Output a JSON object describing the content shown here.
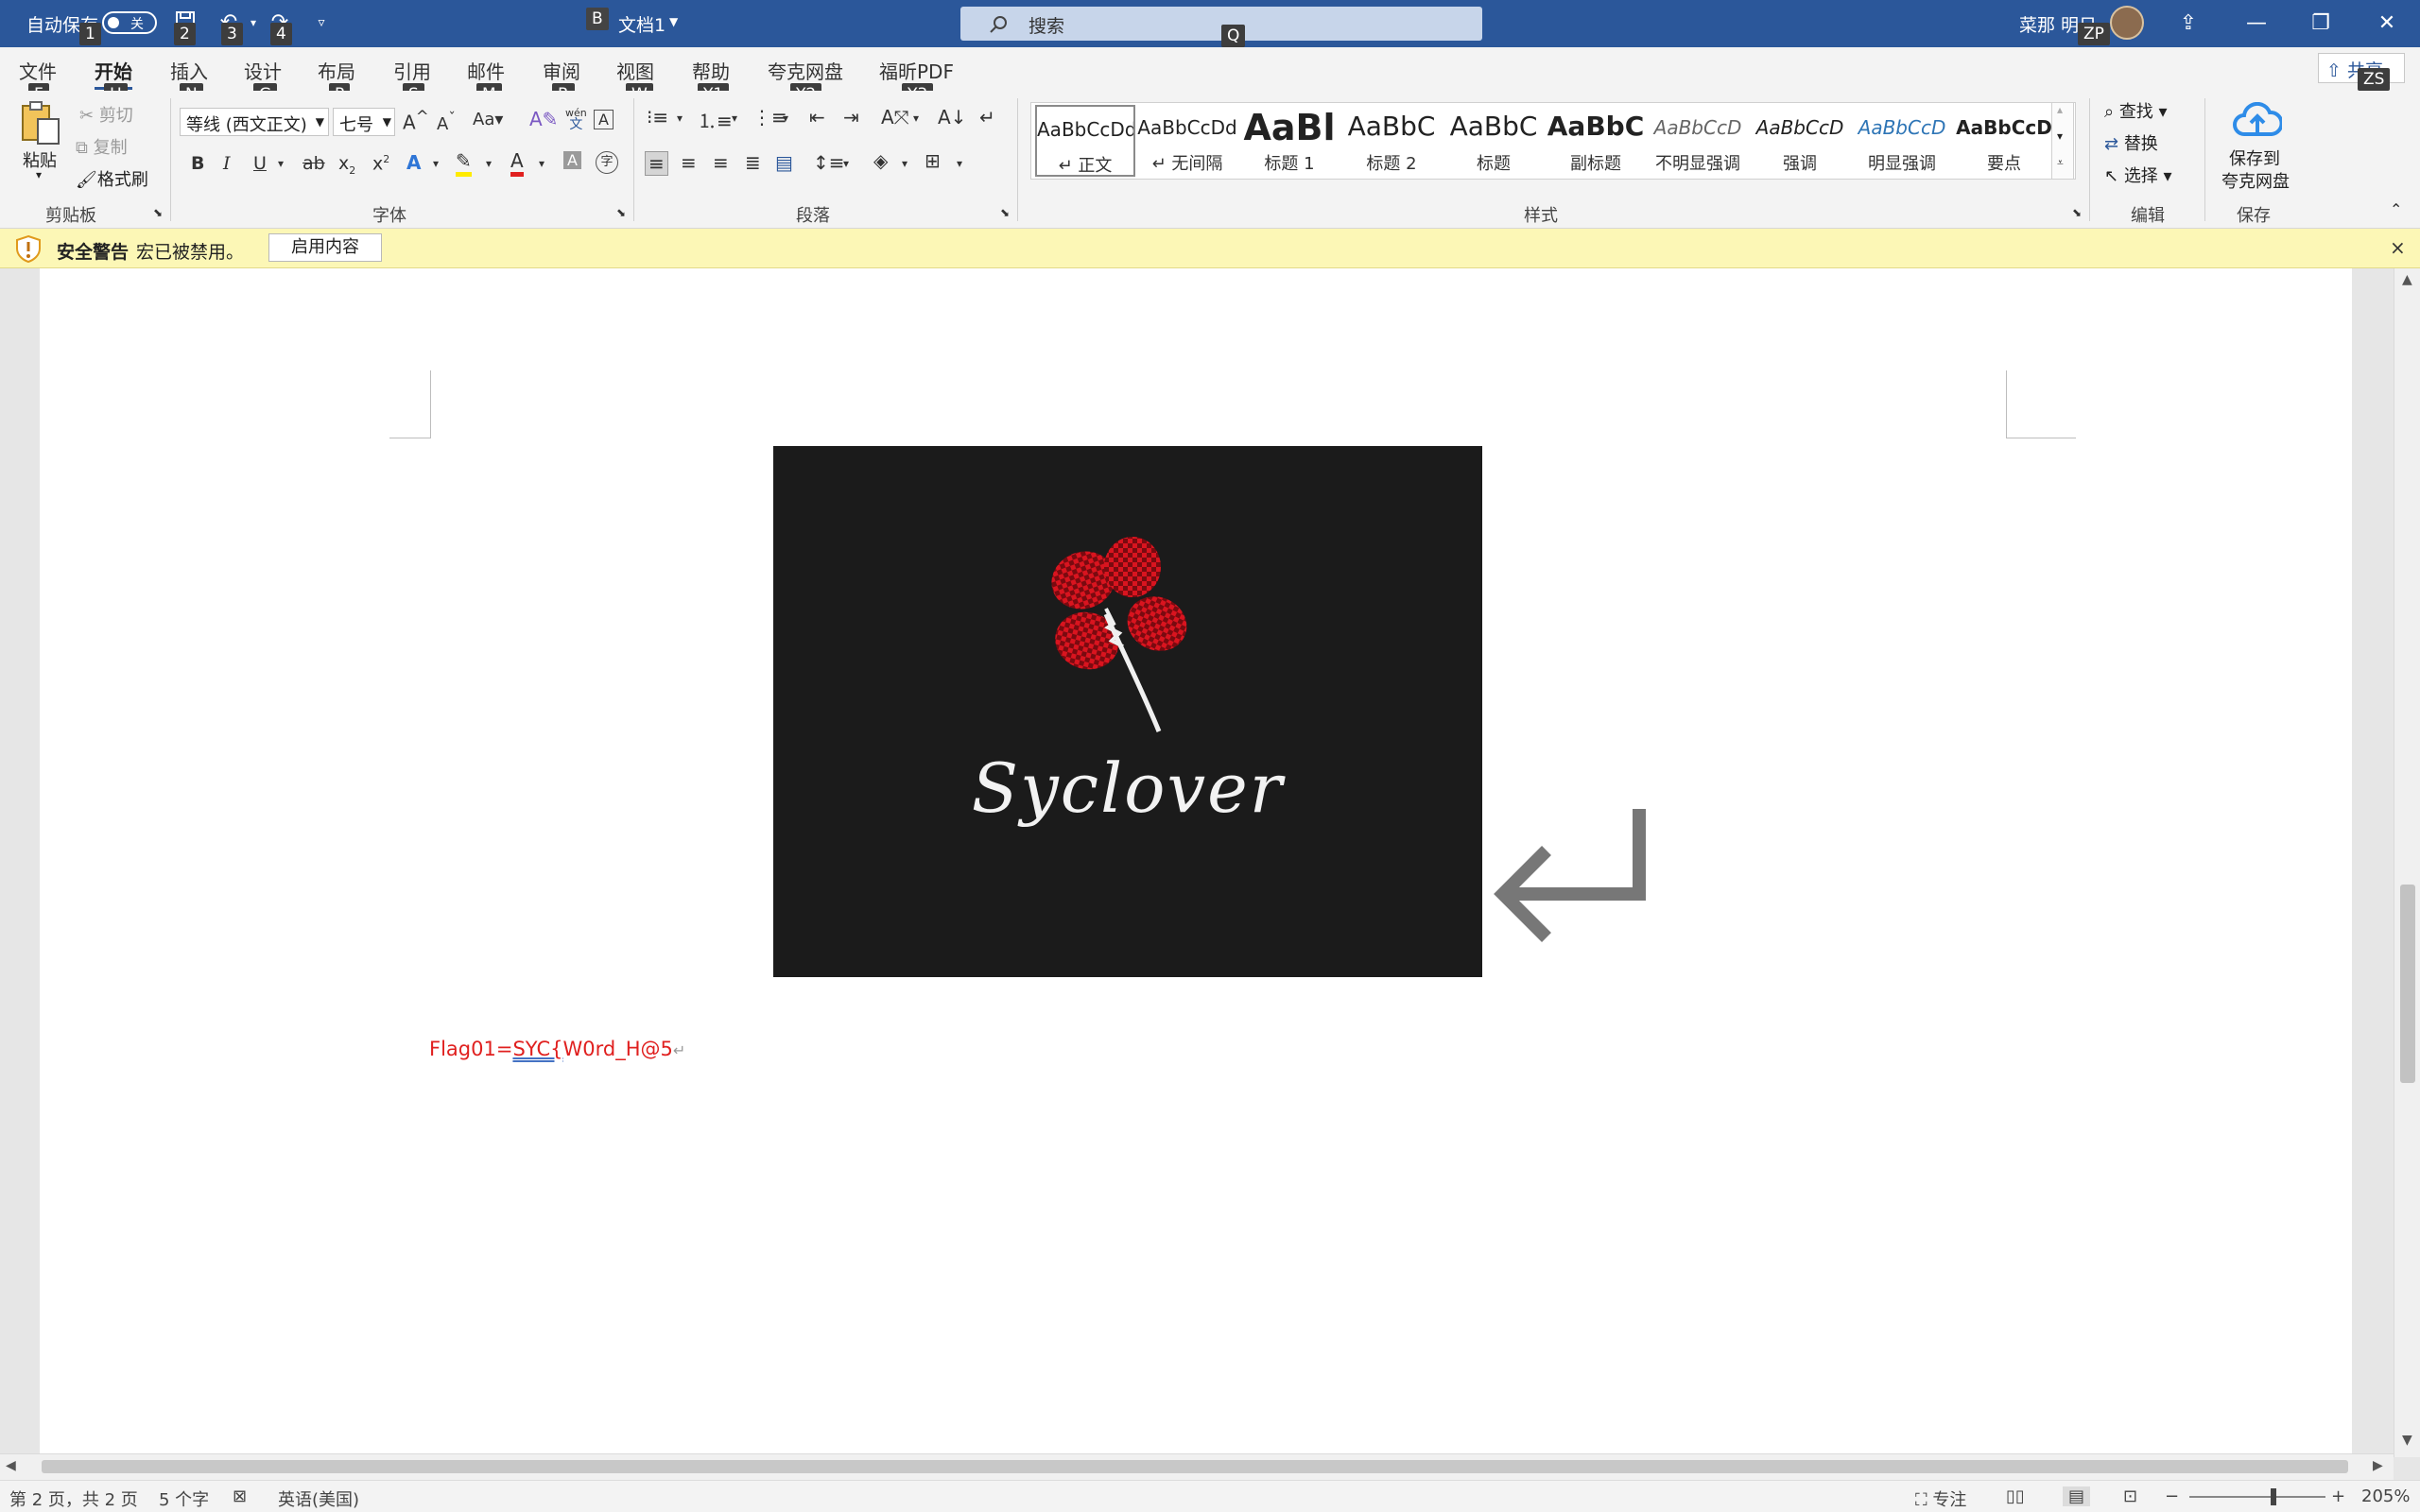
{
  "titlebar": {
    "autosave_label": "自动保存",
    "autosave_state": "关",
    "doc_name": "文档1",
    "doc_badge": "B",
    "search_placeholder": "搜索",
    "user_name": "菜那 明日",
    "keytips": {
      "autosave": "1",
      "save": "2",
      "undo": "3",
      "redo": "4",
      "search": "Q",
      "account": "ZP",
      "share": "ZS"
    }
  },
  "tabs": [
    {
      "label": "文件",
      "keytip": "F"
    },
    {
      "label": "开始",
      "keytip": "H"
    },
    {
      "label": "插入",
      "keytip": "N"
    },
    {
      "label": "设计",
      "keytip": "G"
    },
    {
      "label": "布局",
      "keytip": "P"
    },
    {
      "label": "引用",
      "keytip": "S"
    },
    {
      "label": "邮件",
      "keytip": "M"
    },
    {
      "label": "审阅",
      "keytip": "R"
    },
    {
      "label": "视图",
      "keytip": "W"
    },
    {
      "label": "帮助",
      "keytip": "Y1"
    },
    {
      "label": "夸克网盘",
      "keytip": "Y2"
    },
    {
      "label": "福昕PDF",
      "keytip": "Y3"
    }
  ],
  "share_label": "共享",
  "clipboard": {
    "paste": "粘贴",
    "cut": "剪切",
    "copy": "复制",
    "format_painter": "格式刷",
    "group": "剪贴板"
  },
  "font": {
    "name": "等线 (西文正文)",
    "size": "七号",
    "group": "字体",
    "case_btn": "Aa",
    "phonetic_top": "wén",
    "phonetic_bottom": "文",
    "border_char": "A",
    "enclose_char": "字"
  },
  "paragraph": {
    "group": "段落"
  },
  "styles": {
    "group": "样式",
    "items": [
      {
        "sample": "AaBbCcDd",
        "name": "正文"
      },
      {
        "sample": "AaBbCcDd",
        "name": "无间隔"
      },
      {
        "sample": "AaBl",
        "name": "标题 1"
      },
      {
        "sample": "AaBbC",
        "name": "标题 2"
      },
      {
        "sample": "AaBbC",
        "name": "标题"
      },
      {
        "sample": "AaBbC",
        "name": "副标题"
      },
      {
        "sample": "AaBbCcD",
        "name": "不明显强调"
      },
      {
        "sample": "AaBbCcD",
        "name": "强调"
      },
      {
        "sample": "AaBbCcD",
        "name": "明显强调"
      },
      {
        "sample": "AaBbCcD",
        "name": "要点"
      }
    ]
  },
  "editing": {
    "find": "查找",
    "replace": "替换",
    "select": "选择",
    "group": "编辑"
  },
  "save_cloud": {
    "line1": "保存到",
    "line2": "夸克网盘",
    "group": "保存"
  },
  "security": {
    "title": "安全警告",
    "message": "宏已被禁用。",
    "button": "启用内容"
  },
  "document": {
    "image_caption": "Syclover",
    "flag_prefix": "Flag01=",
    "flag_squiggle": "SYC{",
    "flag_rest": "W0rd_H@5",
    "pilcrow": "↵"
  },
  "statusbar": {
    "page": "第 2 页，共 2 页",
    "words": "5 个字",
    "language": "英语(美国)",
    "focus": "专注",
    "zoom": "205%"
  },
  "colors": {
    "brand": "#2b579a",
    "flag_text": "#e0201f",
    "security_bg": "#fcf7b6"
  }
}
